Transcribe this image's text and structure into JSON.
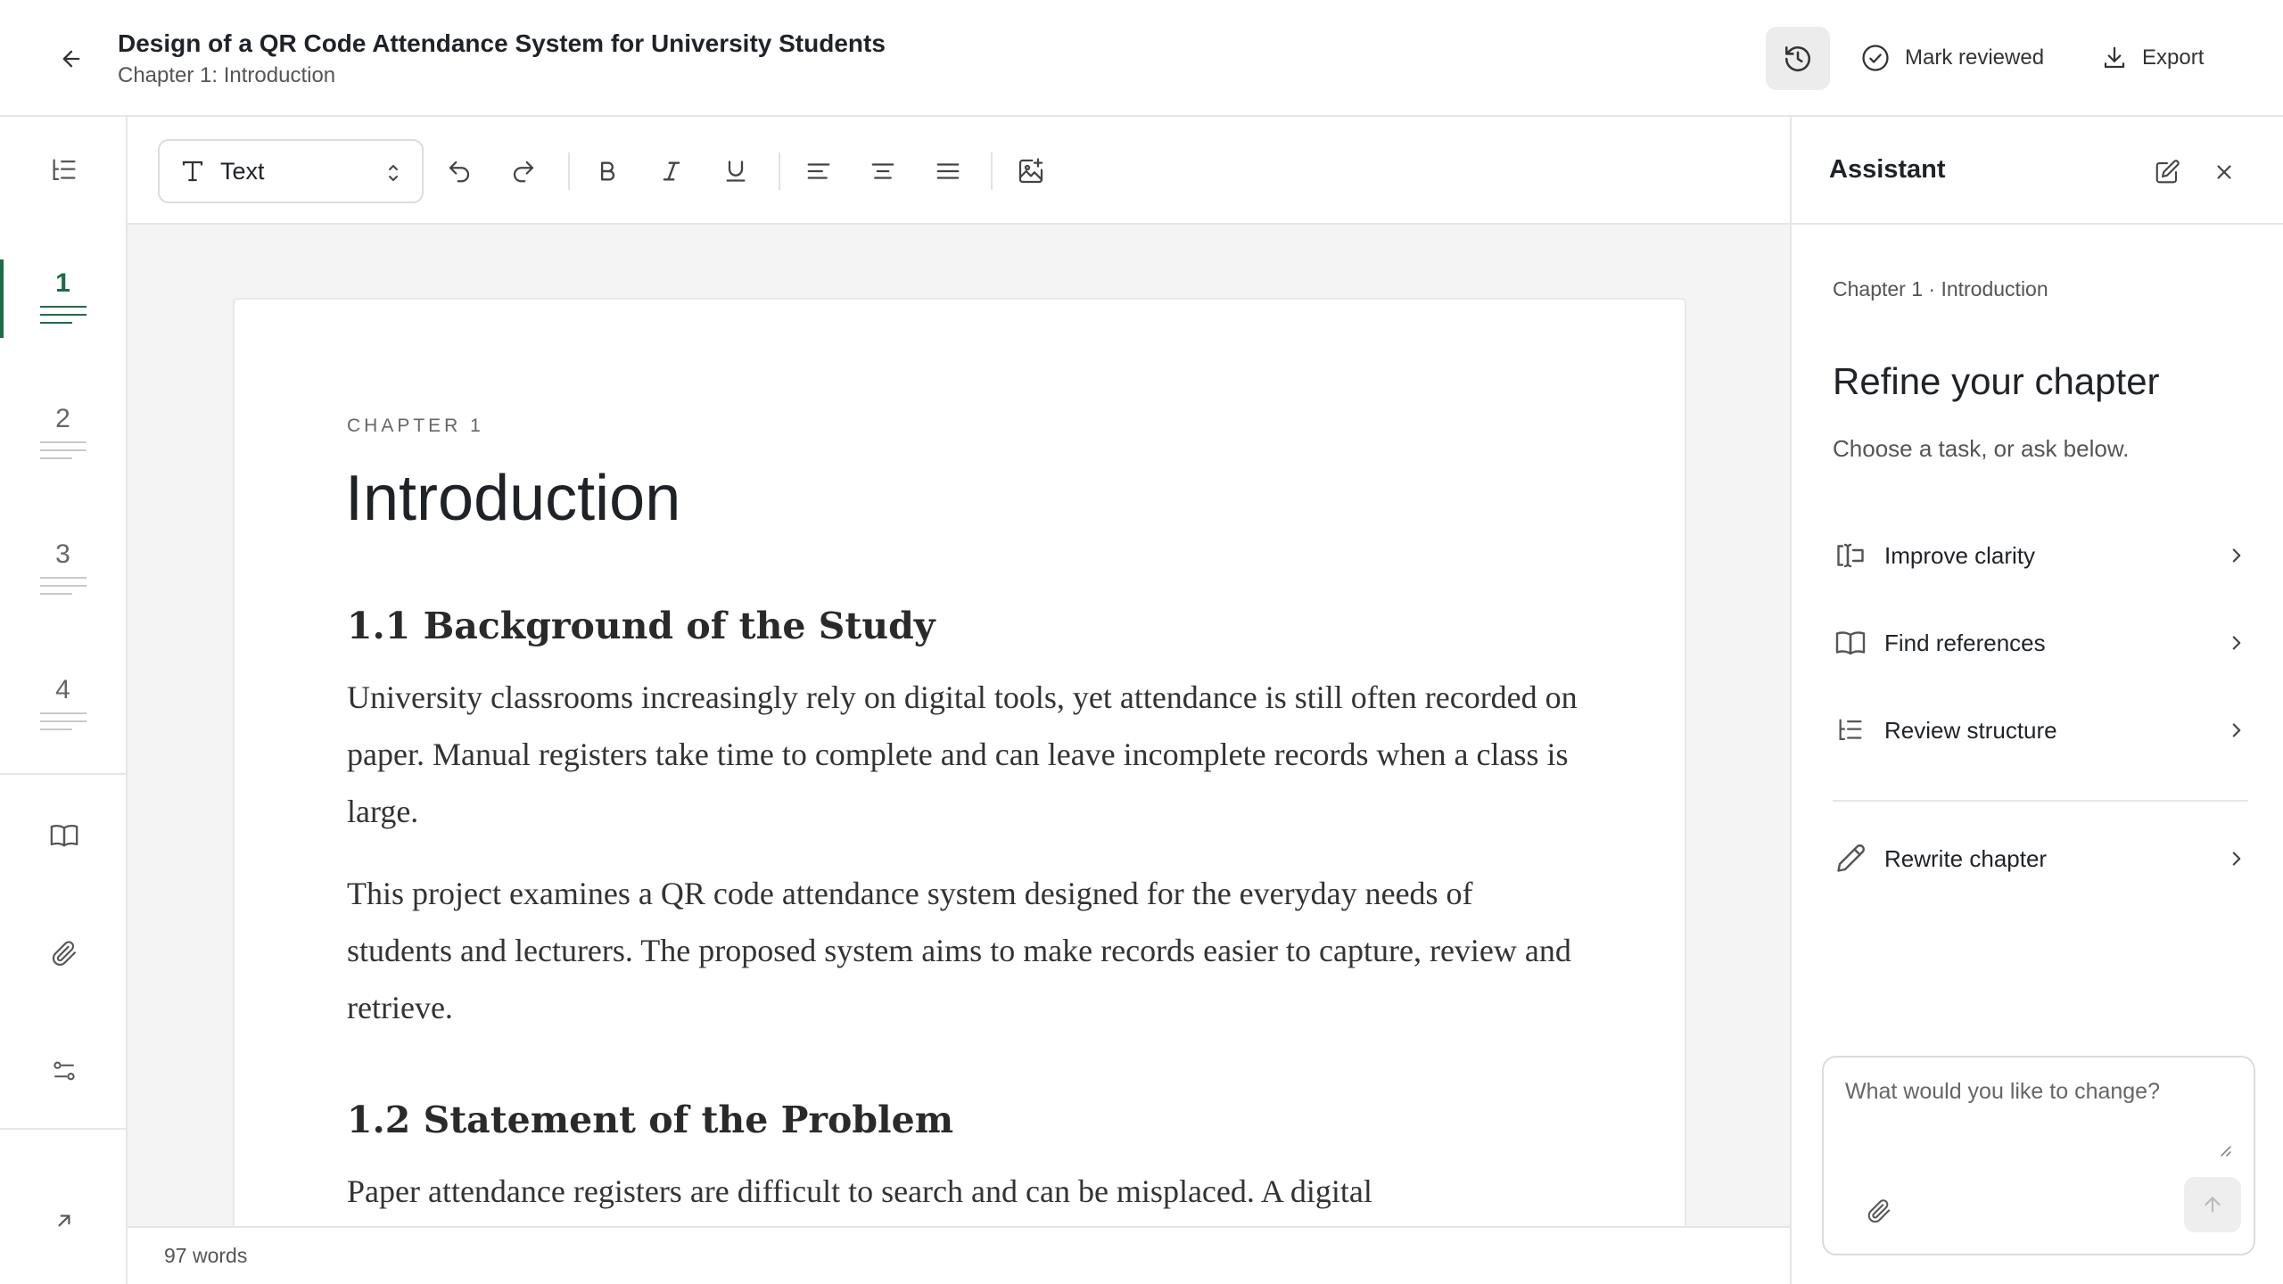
{
  "header": {
    "title": "Design of a QR Code Attendance System for University Students",
    "subtitle": "Chapter 1: Introduction",
    "mark_reviewed_label": "Mark reviewed",
    "export_label": "Export"
  },
  "sidebar": {
    "chapters": [
      {
        "number": "1",
        "active": true
      },
      {
        "number": "2",
        "active": false
      },
      {
        "number": "3",
        "active": false
      },
      {
        "number": "4",
        "active": false
      }
    ]
  },
  "toolbar": {
    "style_value": "Text"
  },
  "document": {
    "eyebrow": "CHAPTER 1",
    "chapter_title": "Introduction",
    "sections": [
      {
        "heading": "1.1 Background of the Study",
        "paragraphs": [
          "University classrooms increasingly rely on digital tools, yet attendance is still often recorded on paper. Manual registers take time to complete and can leave incomplete records when a class is large.",
          "This project examines a QR code attendance system designed for the everyday needs of students and lecturers. The proposed system aims to make records easier to capture, review and retrieve."
        ]
      },
      {
        "heading": "1.2 Statement of the Problem",
        "paragraphs": [
          "Paper attendance registers are difficult to search and can be misplaced. A digital"
        ]
      }
    ]
  },
  "status_bar": {
    "word_count": "97 words"
  },
  "assistant": {
    "title": "Assistant",
    "breadcrumb": "Chapter 1 · Introduction",
    "heading": "Refine your chapter",
    "subheading": "Choose a task, or ask below.",
    "tasks": [
      {
        "label": "Improve clarity",
        "icon": "text-cursor-icon"
      },
      {
        "label": "Find references",
        "icon": "book-icon"
      },
      {
        "label": "Review structure",
        "icon": "list-tree-icon"
      },
      {
        "label": "Rewrite chapter",
        "icon": "pencil-icon"
      }
    ],
    "input_placeholder": "What would you like to change?"
  },
  "colors": {
    "accent": "#1e6b4a",
    "canvas_bg": "#f4f4f4",
    "border": "#e6e6e6"
  }
}
